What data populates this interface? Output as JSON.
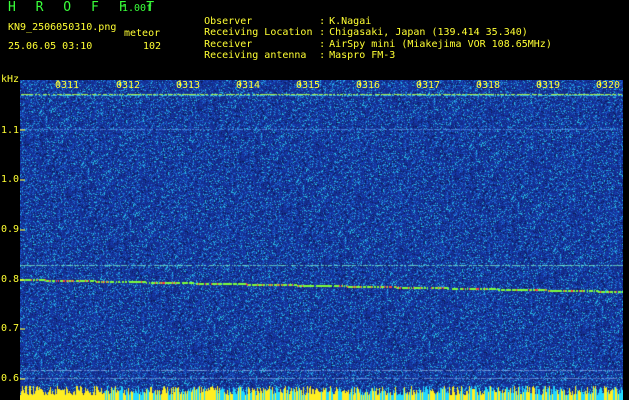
{
  "header": {
    "title": "H R O F F T",
    "version": "1.00f",
    "filename": "KN9_2506050310.png",
    "meteor_label": "meteor",
    "timestamp": "25.06.05 03:10",
    "meteor_count": "102"
  },
  "info": [
    {
      "key": "Observer",
      "value": "K.Nagai"
    },
    {
      "key": "Receiving Location",
      "value": "Chigasaki, Japan (139.414 35.340)"
    },
    {
      "key": "Receiver",
      "value": "AirSpy mini (Miakejima VOR 108.65MHz)"
    },
    {
      "key": "Receiving antenna",
      "value": "Maspro FM-3"
    }
  ],
  "axis": {
    "unit": "kHz",
    "y_ticks": [
      "1.1",
      "1.0",
      "0.9",
      "0.8",
      "0.7",
      "0.6"
    ],
    "x_ticks": [
      "0311",
      "0312",
      "0313",
      "0314",
      "0315",
      "0316",
      "0317",
      "0318",
      "0319",
      "0320"
    ]
  },
  "colors": {
    "background": "#000000",
    "waterfall_base": "#1c3fa8",
    "label_yellow": "#ffff33",
    "title_green": "#39ff3a",
    "trace_green": "#7fff3a",
    "signal_red": "#ff4040"
  }
}
